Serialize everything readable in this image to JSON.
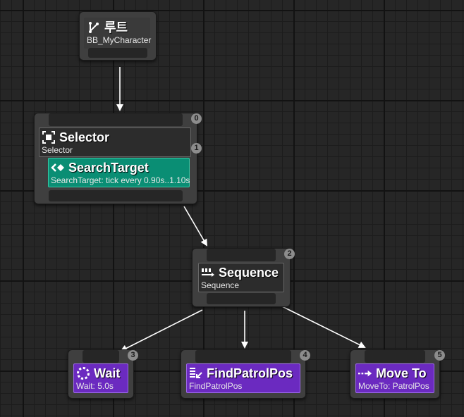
{
  "root": {
    "title": "루트",
    "subtitle": "BB_MyCharacter",
    "icon": "branch-icon"
  },
  "selector": {
    "title": "Selector",
    "subtitle": "Selector",
    "icon": "selector-icon",
    "index_top": "0",
    "index_inner": "1",
    "service": {
      "title": "SearchTarget",
      "subtitle": "SearchTarget: tick every 0.90s..1.10s",
      "icon": "service-icon"
    }
  },
  "sequence": {
    "title": "Sequence",
    "subtitle": "Sequence",
    "icon": "sequence-icon",
    "index": "2"
  },
  "tasks": [
    {
      "title": "Wait",
      "subtitle": "Wait: 5.0s",
      "icon": "wait-icon",
      "index": "3"
    },
    {
      "title": "FindPatrolPos",
      "subtitle": "FindPatrolPos",
      "icon": "task-icon",
      "index": "4"
    },
    {
      "title": "Move To",
      "subtitle": "MoveTo: PatrolPos",
      "icon": "move-to-icon",
      "index": "5"
    }
  ],
  "colors": {
    "composite": "#2c2c2c",
    "service": "#0a8e74",
    "task": "#6b2ac0",
    "background": "#262626"
  }
}
